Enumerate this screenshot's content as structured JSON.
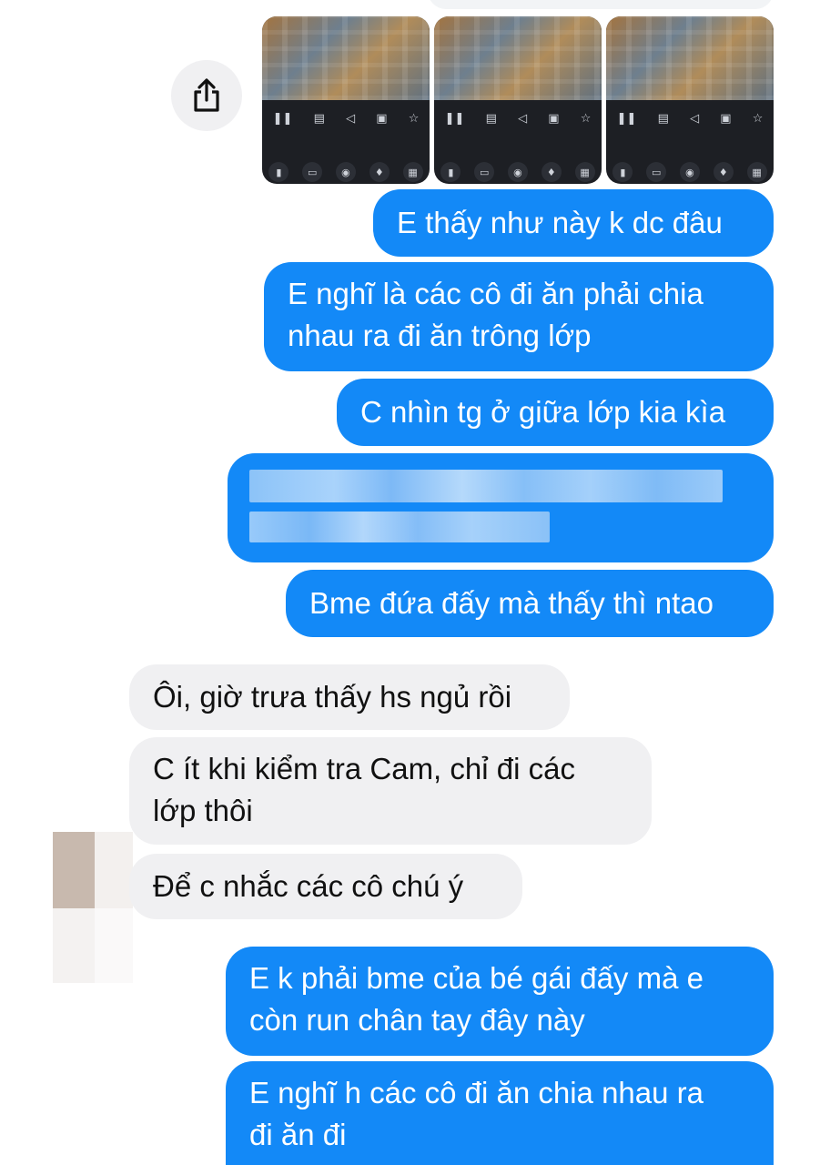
{
  "conversation": {
    "outgoing_1": "E thấy như này k dc đâu",
    "outgoing_2_l1": "E nghĩ là các cô đi ăn phải chia",
    "outgoing_2_l2": "nhau ra đi ăn trông lớp",
    "outgoing_3": "C nhìn tg ở giữa lớp kia kìa",
    "outgoing_5": "Bme đứa đấy mà thấy thì ntao",
    "incoming_1": "Ôi, giờ trưa thấy hs ngủ rồi",
    "incoming_2_l1": "C ít khi kiểm tra Cam, chỉ đi các",
    "incoming_2_l2": "lớp thôi",
    "incoming_3": "Để c nhắc các cô chú ý",
    "outgoing_6_l1": "E k phải bme của bé gái đấy mà e",
    "outgoing_6_l2": "còn run chân tay đây này",
    "outgoing_7_l1": "E nghĩ h các cô đi ăn chia nhau ra",
    "outgoing_7_l2": "đi ăn đi"
  },
  "icons": {
    "share": "share-icon",
    "camera_controls": [
      "pause-icon",
      "grid-icon",
      "speaker-icon",
      "record-icon",
      "star-icon"
    ],
    "camera_tools": [
      "flash-icon",
      "video-icon",
      "camera-icon",
      "mic-icon",
      "menu-icon"
    ]
  },
  "colors": {
    "outgoing_bubble": "#1389f7",
    "incoming_bubble": "#f0f0f2",
    "background": "#ffffff"
  }
}
